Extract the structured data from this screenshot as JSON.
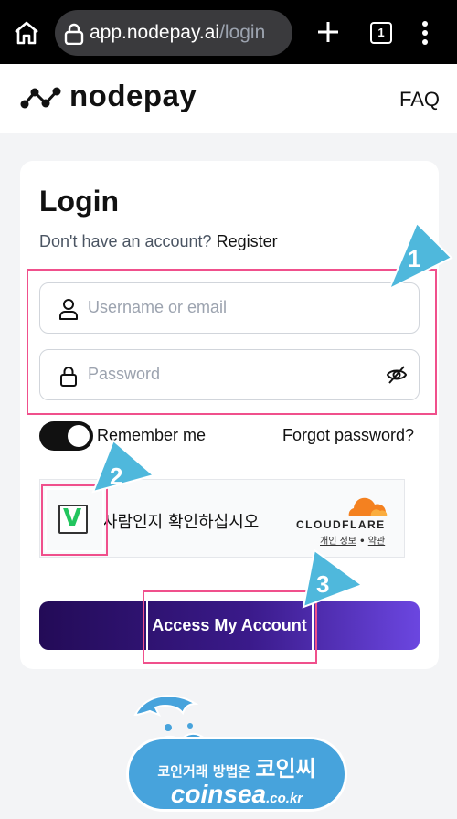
{
  "browser": {
    "url_host": "app.nodepay.ai",
    "url_path": "/login",
    "tab_count": "1"
  },
  "header": {
    "logo_text": "nodepay",
    "faq_label": "FAQ"
  },
  "login": {
    "title": "Login",
    "signup_prompt": "Don't have an account?",
    "register_label": "Register",
    "username_placeholder": "Username or email",
    "password_placeholder": "Password",
    "remember_label": "Remember me",
    "remember_checked": true,
    "forgot_label": "Forgot password?",
    "submit_label": "Access My Account"
  },
  "captcha": {
    "check_mark": "V",
    "prompt": "사람인지 확인하십시오",
    "brand": "CLOUDFLARE",
    "privacy_label": "개인 정보",
    "separator": "•",
    "terms_label": "약관"
  },
  "annotations": [
    "1",
    "2",
    "3"
  ],
  "watermark": {
    "line1_prefix": "코인거래 방법은",
    "line1_brand": "코인씨",
    "line2_main": "coinsea",
    "line2_suffix": ".co.kr"
  },
  "colors": {
    "annotation_border": "#f0508c",
    "annotation_arrow": "#4fb8dc",
    "button_gradient_start": "#230b57",
    "button_gradient_end": "#6b46e0"
  }
}
